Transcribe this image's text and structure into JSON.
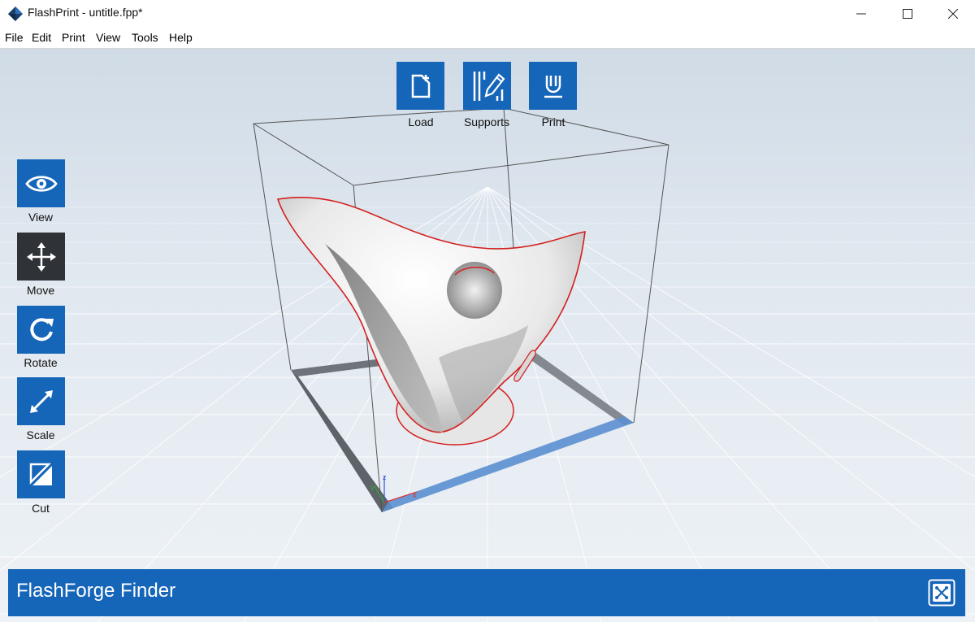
{
  "window": {
    "title": "FlashPrint - untitle.fpp*"
  },
  "menu": {
    "items": [
      "File",
      "Edit",
      "Print",
      "View",
      "Tools",
      "Help"
    ]
  },
  "top_toolbar": {
    "load": {
      "label": "Load",
      "icon": "load-icon"
    },
    "supports": {
      "label": "Supports",
      "icon": "supports-icon"
    },
    "print": {
      "label": "Print",
      "icon": "print-icon"
    }
  },
  "left_toolbar": {
    "view": {
      "label": "View",
      "icon": "eye-icon"
    },
    "move": {
      "label": "Move",
      "icon": "move-icon",
      "active": true
    },
    "rotate": {
      "label": "Rotate",
      "icon": "rotate-icon"
    },
    "scale": {
      "label": "Scale",
      "icon": "scale-icon"
    },
    "cut": {
      "label": "Cut",
      "icon": "cut-icon"
    }
  },
  "axes": {
    "x": "x",
    "y": "y",
    "z": "z"
  },
  "status_bar": {
    "printer": "FlashForge Finder",
    "connect_icon": "connect-printer-icon"
  },
  "colors": {
    "accent": "#1565b8",
    "active_tool": "#2f3338",
    "model_outline": "#d42020",
    "viewport_bg": "#d4dee8"
  }
}
